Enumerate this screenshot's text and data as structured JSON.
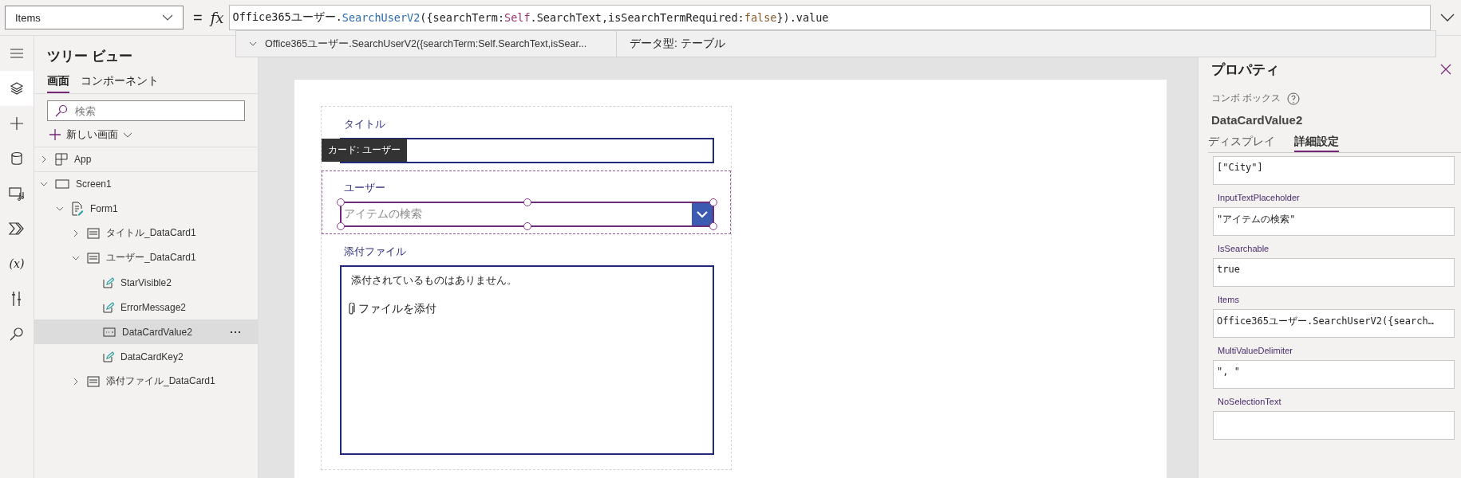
{
  "formula_bar": {
    "property": "Items",
    "equals": "=",
    "fx": "fx",
    "tokens": [
      {
        "kind": "text",
        "text": "Office365ユーザー."
      },
      {
        "kind": "function",
        "text": "SearchUserV2"
      },
      {
        "kind": "text",
        "text": "({searchTerm:"
      },
      {
        "kind": "keyword",
        "text": "Self"
      },
      {
        "kind": "text",
        "text": ".SearchText,isSearchTermRequired:"
      },
      {
        "kind": "literal",
        "text": "false"
      },
      {
        "kind": "text",
        "text": "}).value"
      }
    ]
  },
  "autocomplete": {
    "expression": "Office365ユーザー.SearchUserV2({searchTerm:Self.SearchText,isSear...",
    "data_type": "データ型: テーブル"
  },
  "rail": [
    {
      "kind": "menu",
      "selected": false
    },
    {
      "kind": "layers",
      "selected": true
    },
    {
      "kind": "insert",
      "selected": false
    },
    {
      "kind": "data",
      "selected": false
    },
    {
      "kind": "media",
      "selected": false
    },
    {
      "kind": "automate",
      "selected": false
    },
    {
      "kind": "variables",
      "text": "(x)",
      "selected": false
    },
    {
      "kind": "tools",
      "selected": false
    },
    {
      "kind": "search",
      "selected": false
    }
  ],
  "tree": {
    "title": "ツリー ビュー",
    "tabs": [
      {
        "label": "画面",
        "selected": true
      },
      {
        "label": "コンポーネント",
        "selected": false
      }
    ],
    "search": {
      "placeholder": "検索"
    },
    "new_screen": "新しい画面",
    "items": [
      {
        "label": "App",
        "kind": "app",
        "expanded": false,
        "selected": false
      },
      {
        "label": "Screen1",
        "kind": "screen",
        "expanded": true,
        "selected": false,
        "children": [
          {
            "label": "Form1",
            "kind": "form",
            "expanded": true,
            "selected": false,
            "children": [
              {
                "label": "タイトル_DataCard1",
                "kind": "card",
                "expanded": false,
                "selected": false
              },
              {
                "label": "ユーザー_DataCard1",
                "kind": "card",
                "expanded": true,
                "selected": false,
                "children": [
                  {
                    "label": "StarVisible2",
                    "kind": "label",
                    "selected": false
                  },
                  {
                    "label": "ErrorMessage2",
                    "kind": "label",
                    "selected": false
                  },
                  {
                    "label": "DataCardValue2",
                    "kind": "combobox",
                    "selected": true
                  },
                  {
                    "label": "DataCardKey2",
                    "kind": "label",
                    "selected": false
                  }
                ]
              },
              {
                "label": "添付ファイル_DataCard1",
                "kind": "card",
                "expanded": false,
                "selected": false
              }
            ]
          }
        ]
      }
    ]
  },
  "canvas": {
    "tooltip": "カード: ユーザー",
    "cards": [
      {
        "kind": "text",
        "label": "タイトル",
        "selected": false
      },
      {
        "kind": "combo",
        "label": "ユーザー",
        "placeholder": "アイテムの検索",
        "selected": true
      },
      {
        "kind": "attachments",
        "label": "添付ファイル",
        "empty_text": "添付されているものはありません。",
        "add_label": "ファイルを添付",
        "selected": false
      }
    ]
  },
  "properties": {
    "title": "プロパティ",
    "control_type": "コンボ ボックス",
    "control_name": "DataCardValue2",
    "tabs": [
      {
        "label": "ディスプレイ",
        "selected": false
      },
      {
        "label": "詳細設定",
        "selected": true
      }
    ],
    "fields": [
      {
        "value": "[\"City\"]"
      },
      {
        "label": "InputTextPlaceholder",
        "value": "\"アイテムの検索\""
      },
      {
        "label": "IsSearchable",
        "value": "true"
      },
      {
        "label": "Items",
        "value": "Office365ユーザー.SearchUserV2({search…"
      },
      {
        "label": "MultiValueDelimiter",
        "value": "\", \""
      },
      {
        "label": "NoSelectionText"
      }
    ]
  }
}
